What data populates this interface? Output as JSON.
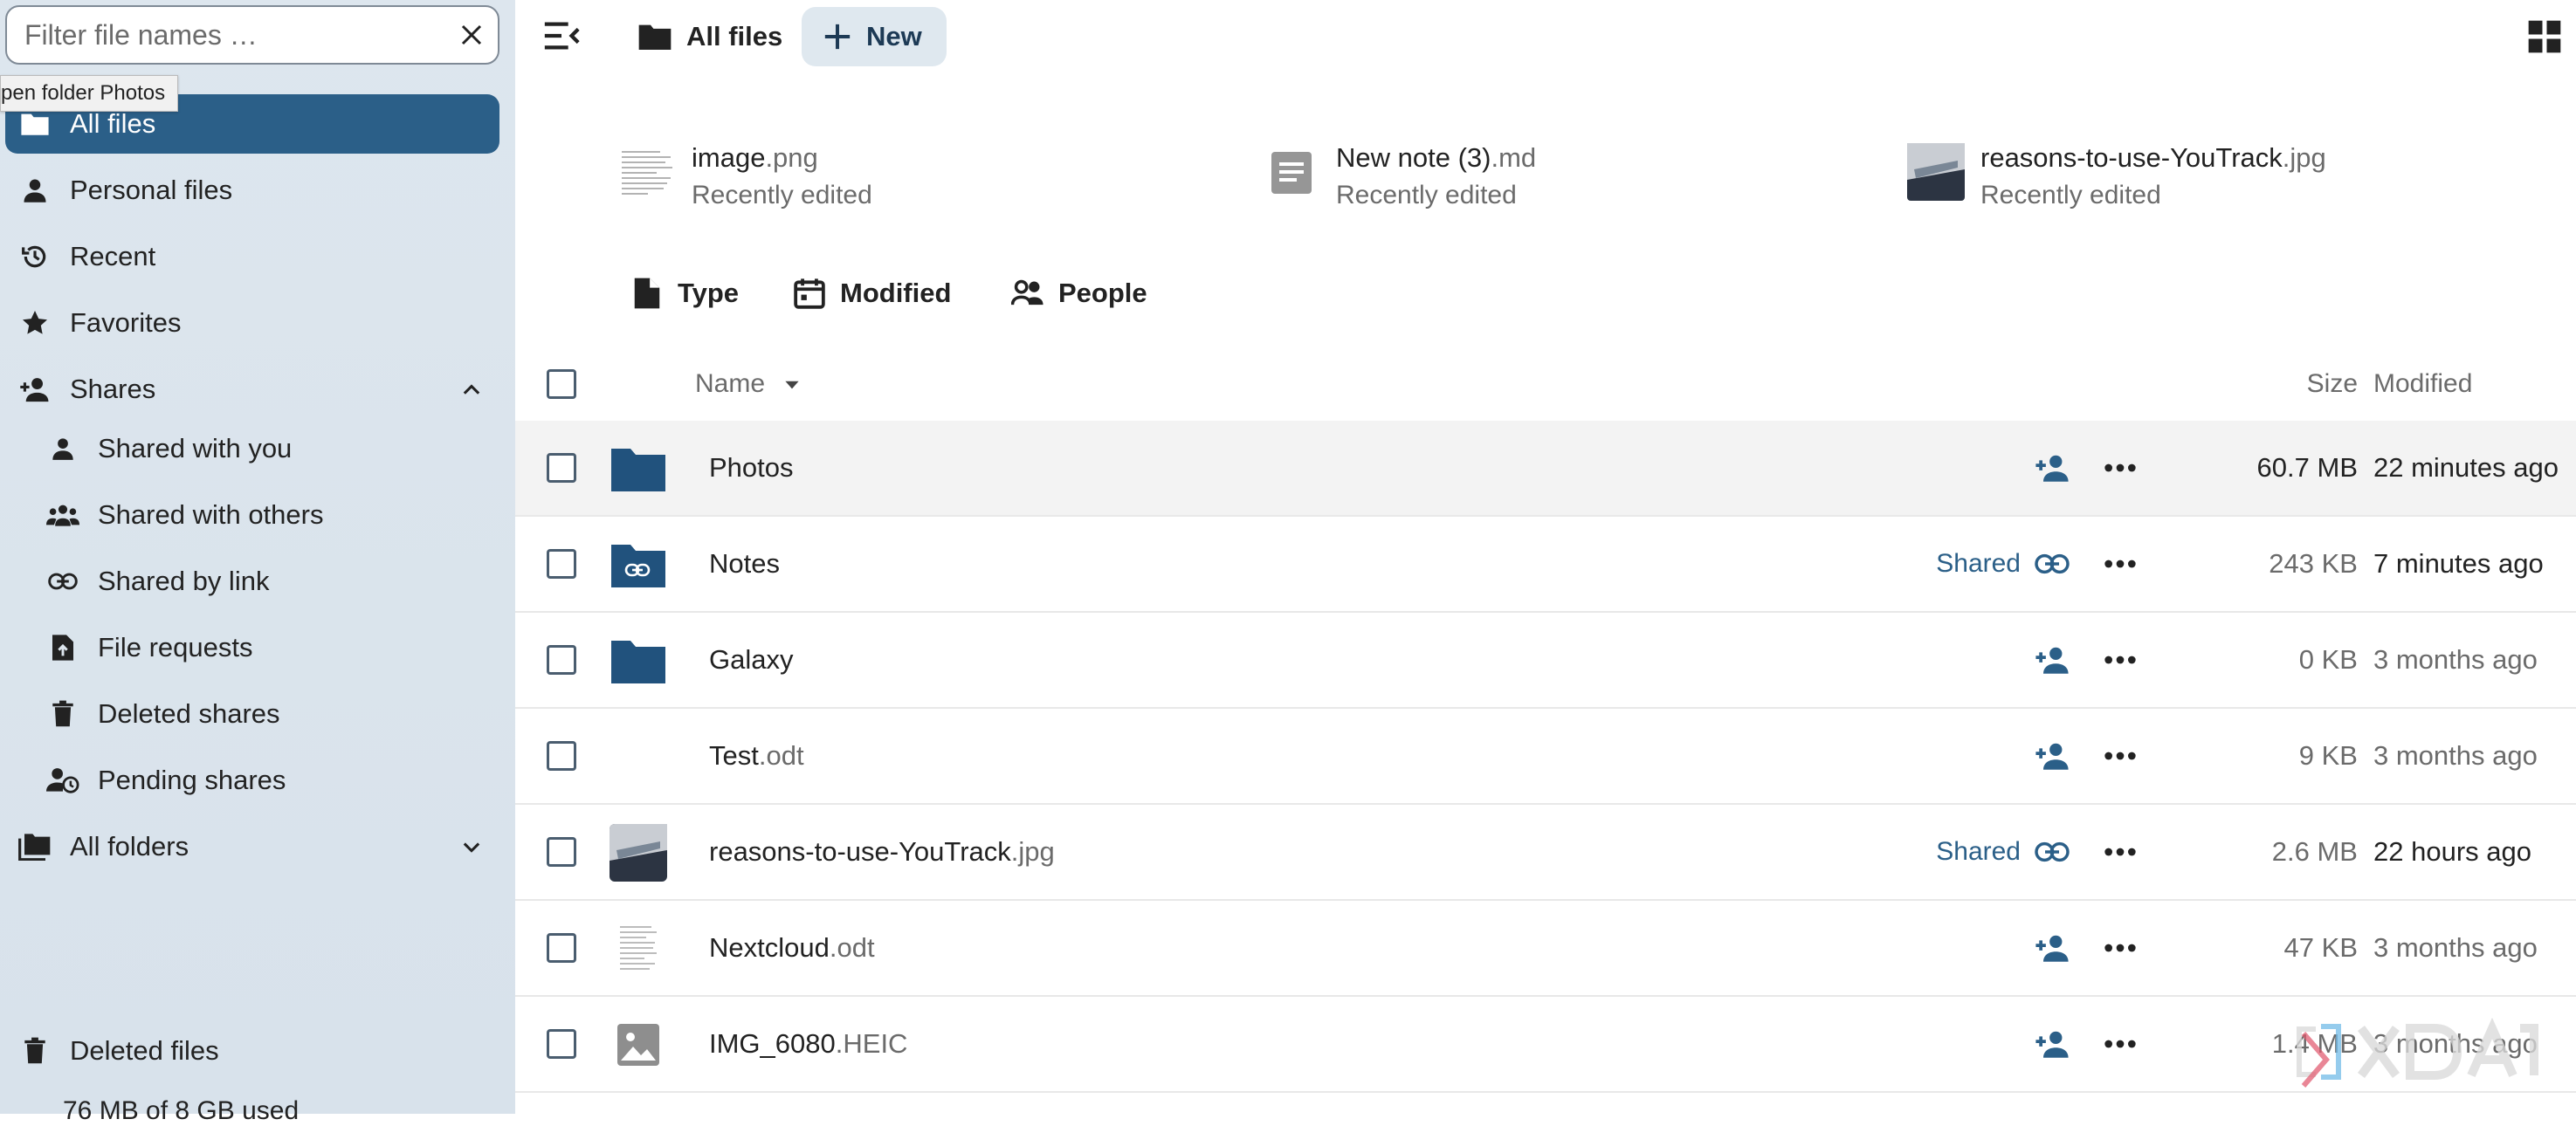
{
  "sidebar": {
    "filter_placeholder": "Filter file names …",
    "tooltip": "pen folder Photos",
    "items": [
      {
        "label": "All files"
      },
      {
        "label": "Personal files"
      },
      {
        "label": "Recent"
      },
      {
        "label": "Favorites"
      },
      {
        "label": "Shares"
      },
      {
        "label": "Shared with you"
      },
      {
        "label": "Shared with others"
      },
      {
        "label": "Shared by link"
      },
      {
        "label": "File requests"
      },
      {
        "label": "Deleted shares"
      },
      {
        "label": "Pending shares"
      },
      {
        "label": "All folders"
      }
    ],
    "deleted_files": "Deleted files",
    "storage": "76 MB of 8 GB used"
  },
  "header": {
    "breadcrumb": "All files",
    "new_label": "New"
  },
  "recent": [
    {
      "name": "image",
      "ext": ".png",
      "sub": "Recently edited"
    },
    {
      "name": "New note (3)",
      "ext": ".md",
      "sub": "Recently edited"
    },
    {
      "name": "reasons-to-use-YouTrack",
      "ext": ".jpg",
      "sub": "Recently edited"
    }
  ],
  "filters": {
    "type": "Type",
    "modified": "Modified",
    "people": "People"
  },
  "columns": {
    "name": "Name",
    "size": "Size",
    "modified": "Modified"
  },
  "files": [
    {
      "name": "Photos",
      "ext": "",
      "share": "",
      "size": "60.7 MB",
      "modified": "22 minutes ago"
    },
    {
      "name": "Notes",
      "ext": "",
      "share": "Shared",
      "size": "243 KB",
      "modified": "7 minutes ago"
    },
    {
      "name": "Galaxy",
      "ext": "",
      "share": "",
      "size": "0 KB",
      "modified": "3 months ago"
    },
    {
      "name": "Test",
      "ext": ".odt",
      "share": "",
      "size": "9 KB",
      "modified": "3 months ago"
    },
    {
      "name": "reasons-to-use-YouTrack",
      "ext": ".jpg",
      "share": "Shared",
      "size": "2.6 MB",
      "modified": "22 hours ago"
    },
    {
      "name": "Nextcloud",
      "ext": ".odt",
      "share": "",
      "size": "47 KB",
      "modified": "3 months ago"
    },
    {
      "name": "IMG_6080",
      "ext": ".HEIC",
      "share": "",
      "size": "1.4 MB",
      "modified": "3 months ago"
    }
  ],
  "colors": {
    "accent": "#2b5f88",
    "folder": "#21527d",
    "sidebar_bg": "#dde6ee"
  }
}
